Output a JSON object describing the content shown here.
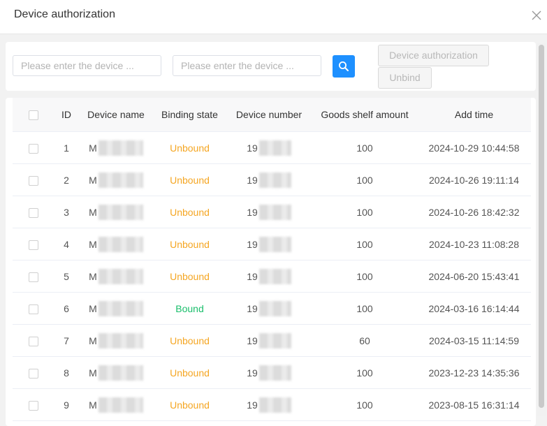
{
  "dialog": {
    "title": "Device authorization"
  },
  "toolbar": {
    "device_name_placeholder": "Please enter the device ...",
    "device_number_placeholder": "Please enter the device ...",
    "device_name_value": "",
    "device_number_value": "",
    "authorize_label": "Device authorization",
    "unbind_label": "Unbind"
  },
  "table": {
    "columns": [
      "ID",
      "Device name",
      "Binding state",
      "Device number",
      "Goods shelf amount",
      "Add time"
    ],
    "rows": [
      {
        "id": "1",
        "name_prefix": "M",
        "state": "Unbound",
        "number_prefix": "19",
        "amount": "100",
        "add_time": "2024-10-29 10:44:58"
      },
      {
        "id": "2",
        "name_prefix": "M",
        "state": "Unbound",
        "number_prefix": "19",
        "amount": "100",
        "add_time": "2024-10-26 19:11:14"
      },
      {
        "id": "3",
        "name_prefix": "M",
        "state": "Unbound",
        "number_prefix": "19",
        "amount": "100",
        "add_time": "2024-10-26 18:42:32"
      },
      {
        "id": "4",
        "name_prefix": "M",
        "state": "Unbound",
        "number_prefix": "19",
        "amount": "100",
        "add_time": "2024-10-23 11:08:28"
      },
      {
        "id": "5",
        "name_prefix": "M",
        "state": "Unbound",
        "number_prefix": "19",
        "amount": "100",
        "add_time": "2024-06-20 15:43:41"
      },
      {
        "id": "6",
        "name_prefix": "M",
        "state": "Bound",
        "number_prefix": "19",
        "amount": "100",
        "add_time": "2024-03-16 16:14:44"
      },
      {
        "id": "7",
        "name_prefix": "M",
        "state": "Unbound",
        "number_prefix": "19",
        "amount": "60",
        "add_time": "2024-03-15 11:14:59"
      },
      {
        "id": "8",
        "name_prefix": "M",
        "state": "Unbound",
        "number_prefix": "19",
        "amount": "100",
        "add_time": "2023-12-23 14:35:36"
      },
      {
        "id": "9",
        "name_prefix": "M",
        "state": "Unbound",
        "number_prefix": "19",
        "amount": "100",
        "add_time": "2023-08-15 16:31:14"
      }
    ]
  },
  "icons": {
    "close": "close-icon",
    "search": "search-icon"
  },
  "colors": {
    "primary": "#1e90ff",
    "unbound": "#f5a623",
    "bound": "#19be6b"
  }
}
